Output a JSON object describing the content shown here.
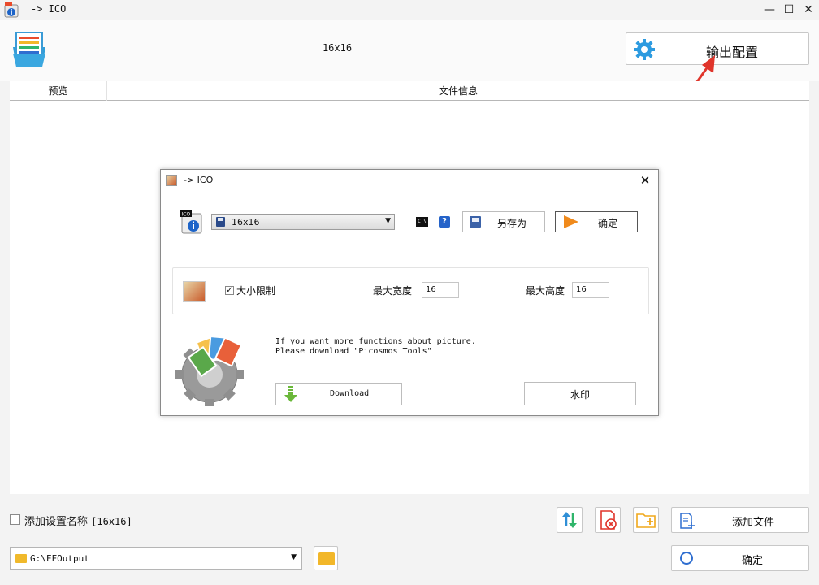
{
  "window": {
    "title": "-> ICO"
  },
  "header": {
    "profile": "16x16",
    "output_config_label": "输出配置"
  },
  "list": {
    "columns": [
      "预览",
      "文件信息"
    ]
  },
  "dialog": {
    "title": "-> ICO",
    "profile_value": "16x16",
    "cmd_label": "C:\\",
    "help_label": "?",
    "save_as_label": "另存为",
    "confirm_label": "确定",
    "size_limit_label": "大小限制",
    "size_limit_checked": true,
    "max_width_label": "最大宽度",
    "max_width_value": "16",
    "max_height_label": "最大高度",
    "max_height_value": "16",
    "promo_text": "If you want more functions about picture.\nPlease download \"Picosmos Tools\"",
    "download_label": "Download",
    "watermark_label": "水印"
  },
  "bottom": {
    "add_name_label": "添加设置名称",
    "add_name_suffix": "[16x16]",
    "add_file_label": "添加文件",
    "path_value": "G:\\FFOutput",
    "confirm_label": "确定"
  },
  "colors": {
    "accent_blue": "#2f6ed0",
    "annotation_red": "#e0352b",
    "folder_yellow": "#f2b729"
  }
}
